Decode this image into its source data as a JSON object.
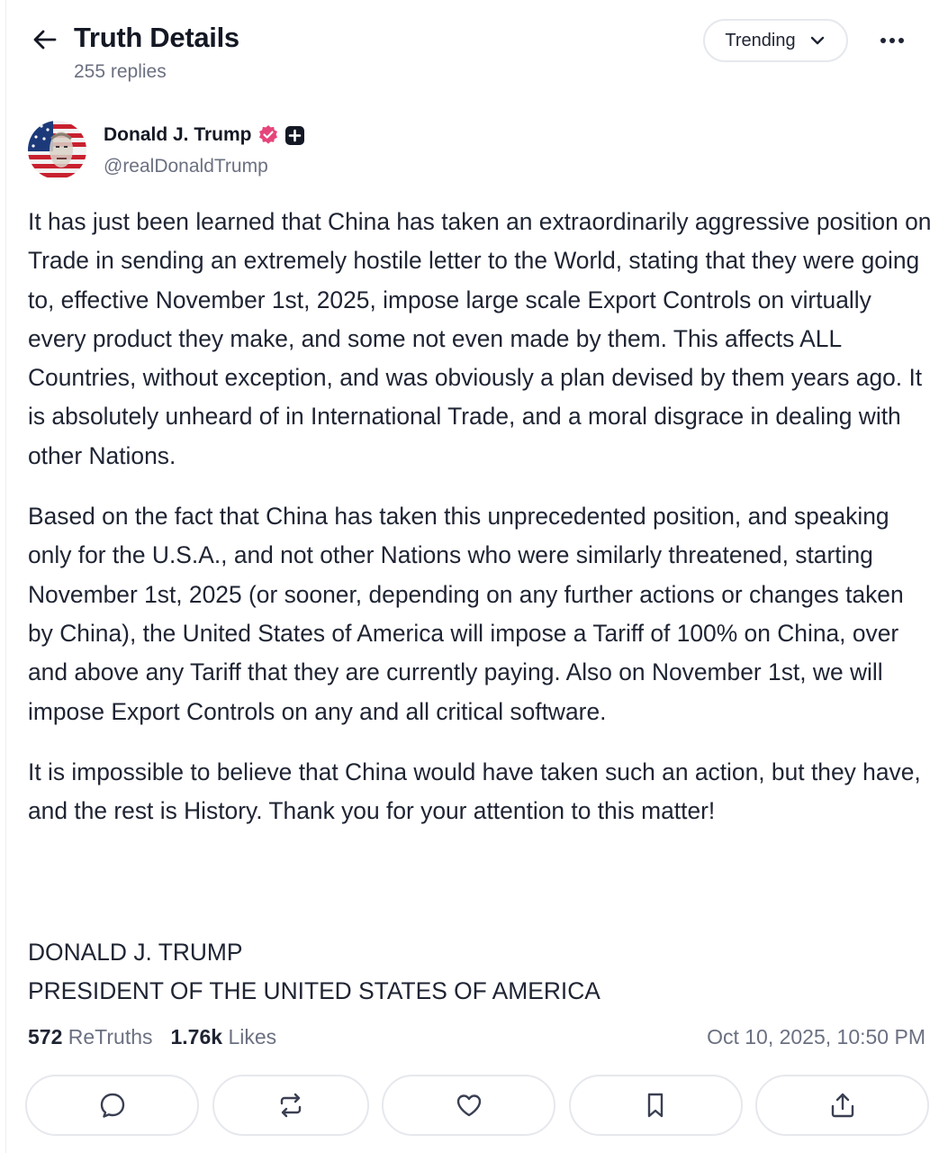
{
  "header": {
    "title": "Truth Details",
    "subtitle": "255 replies",
    "sort_label": "Trending"
  },
  "author": {
    "name": "Donald J. Trump",
    "handle": "@realDonaldTrump",
    "verified_color": "#e5457b"
  },
  "post": {
    "paragraphs": [
      "It has just been learned that China has taken an extraordinarily aggressive position on Trade in sending an extremely hostile letter to the World, stating that they were going to, effective November 1st, 2025, impose large scale Export Controls on virtually every product they make, and some not even made by them. This affects ALL Countries, without exception, and was obviously a plan devised by them years ago. It is absolutely unheard of in International Trade, and a moral disgrace in dealing with other Nations.",
      "Based on the fact that China has taken this unprecedented position, and speaking only for the U.S.A., and not other Nations who were similarly threatened, starting November 1st, 2025 (or sooner, depending on any further actions or changes taken by China), the United States of America will impose a Tariff of 100% on China, over and above any Tariff that they are currently paying. Also on November 1st, we will impose Export Controls on any and all critical software.",
      "It is impossible to believe that China would have taken such an action, but they have, and the rest is History. Thank you for your attention to this matter!"
    ],
    "signature_name": "DONALD J. TRUMP",
    "signature_title": "PRESIDENT OF THE UNITED STATES OF AMERICA"
  },
  "stats": {
    "retruths_count": "572",
    "retruths_label": "ReTruths",
    "likes_count": "1.76k",
    "likes_label": "Likes",
    "timestamp": "Oct 10, 2025, 10:50 PM"
  },
  "actions": [
    {
      "icon": "reply-icon"
    },
    {
      "icon": "retruth-icon"
    },
    {
      "icon": "heart-icon"
    },
    {
      "icon": "bookmark-icon"
    },
    {
      "icon": "share-icon"
    }
  ]
}
